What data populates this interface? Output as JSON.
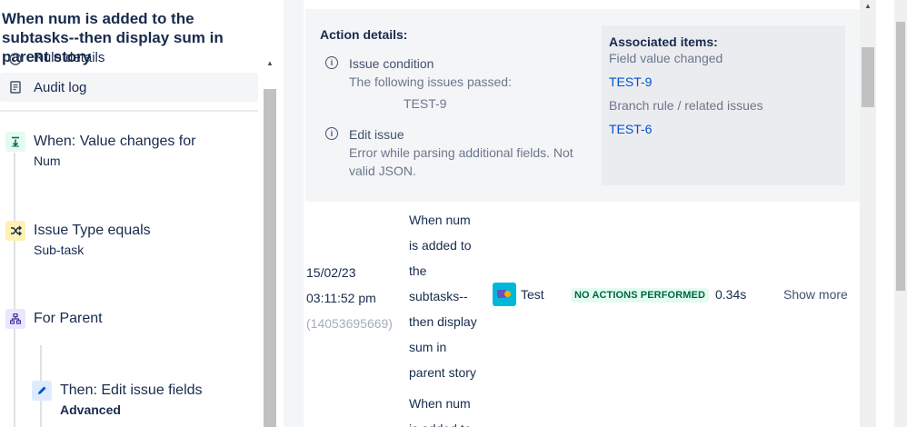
{
  "rule": {
    "title": "When num is added to the subtasks--then display sum in parent story"
  },
  "nav": {
    "rule_details": "Rule details",
    "audit_log": "Audit log"
  },
  "components": {
    "trigger": {
      "title": "When: Value changes for",
      "sub": "Num"
    },
    "condition": {
      "title": "Issue Type equals",
      "sub": "Sub-task"
    },
    "branch": {
      "title": "For Parent"
    },
    "action": {
      "title": "Then: Edit issue fields",
      "sub": "Advanced"
    }
  },
  "details": {
    "title": "Action details:",
    "condition": {
      "head": "Issue condition",
      "body": "The following issues passed:",
      "key": "TEST-9"
    },
    "edit": {
      "head": "Edit issue",
      "body": "Error while parsing additional fields. Not valid JSON."
    },
    "associated": {
      "head": "Associated items:",
      "sub1": "Field value changed",
      "link1": "TEST-9",
      "sub2": "Branch rule / related issues",
      "link2": "TEST-6"
    }
  },
  "row": {
    "date": "15/02/23",
    "time": "03:11:52 pm",
    "id": "(14053695669)",
    "description": "When num is added to the subtasks--then display sum in parent story",
    "description_next": "When num is added to",
    "project": "Test",
    "status": "NO ACTIONS PERFORMED",
    "duration": "0.34s",
    "show_more": "Show more"
  },
  "colors": {
    "status_bg": "#e3fcef",
    "status_text": "#006644",
    "link": "#0052cc"
  }
}
